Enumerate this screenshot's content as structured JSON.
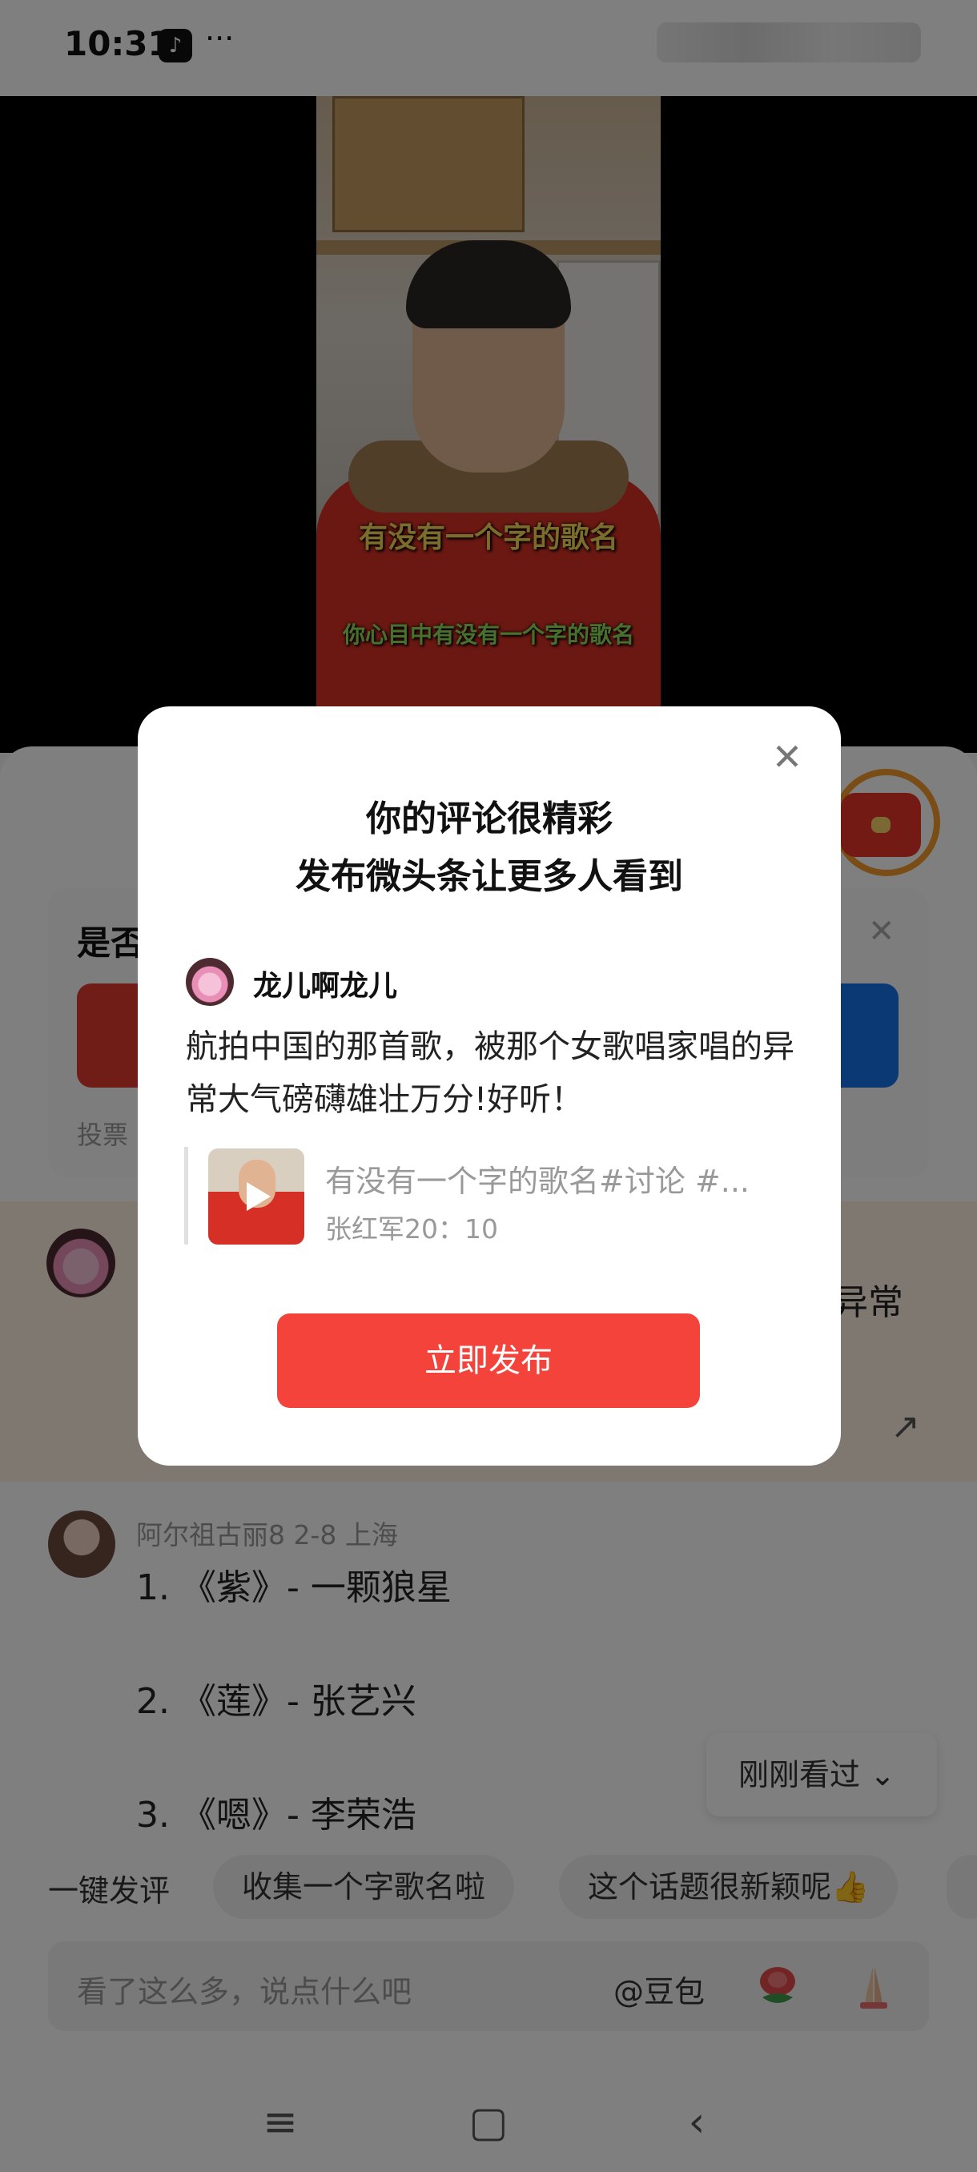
{
  "status_bar": {
    "time": "10:31",
    "more": "···"
  },
  "video": {
    "caption_main": "有没有一个字的歌名",
    "caption_sub": "你心目中有没有一个字的歌名"
  },
  "poll": {
    "title": "是否",
    "note": "投票"
  },
  "highlight_comment": {
    "text_tail": "异常"
  },
  "comment": {
    "meta": "阿尔祖古丽8  2-8  上海",
    "lines": [
      "1. 《紫》- 一颗狼星",
      "2. 《莲》- 张艺兴",
      "3. 《嗯》- 李荣浩"
    ]
  },
  "recently_viewed": "刚刚看过 ⌄",
  "quick_comment": {
    "label": "一键发评",
    "chips": [
      "收集一个字歌名啦",
      "这个话题很新颖呢👍"
    ]
  },
  "input": {
    "placeholder": "看了这么多，说点什么吧",
    "at": "@豆包"
  },
  "dialog": {
    "title_line1": "你的评论很精彩",
    "title_line2": "发布微头条让更多人看到",
    "user": "龙儿啊龙儿",
    "comment": "航拍中国的那首歌，被那个女歌唱家唱的异常大气磅礴雄壮万分!好听！",
    "video_title": "有没有一个字的歌名#讨论 #...",
    "video_author": "张红军20：10",
    "publish_button": "立即发布"
  },
  "colors": {
    "accent_red": "#f4433b",
    "poll_blue": "#1673e6",
    "highlight_bg": "#fdf1e3"
  },
  "icons": [
    "tiktok-icon",
    "close-icon",
    "red-packet-icon",
    "share-icon",
    "chevron-down-icon",
    "rose-emoji-icon",
    "praying-hands-icon",
    "menu-icon",
    "home-icon",
    "back-icon",
    "play-icon"
  ]
}
